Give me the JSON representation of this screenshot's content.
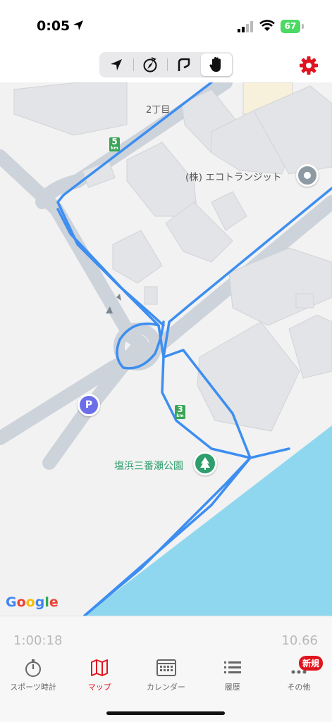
{
  "status_bar": {
    "time": "0:05",
    "battery": "67"
  },
  "toolbar": {
    "modes": [
      "location-arrow-icon",
      "compass-icon",
      "route-icon",
      "hand-icon"
    ],
    "active_mode": "hand-icon",
    "settings_icon": "gear-icon",
    "accent_color": "#e0141e"
  },
  "map": {
    "labels": {
      "block": "2丁目",
      "company": "(株) エコトランジット",
      "park": "塩浜三番瀬公園"
    },
    "km_markers": [
      {
        "value": "5",
        "unit": "km"
      },
      {
        "value": "3",
        "unit": "km"
      }
    ],
    "parking": "P",
    "attribution": "Google",
    "route_color": "#3d8ef0",
    "water_color": "#8fd7ee"
  },
  "stats": {
    "elapsed": "1:00:18",
    "distance": "10.66"
  },
  "tabs": [
    {
      "label": "スポーツ時計",
      "icon": "stopwatch-icon"
    },
    {
      "label": "マップ",
      "icon": "map-icon"
    },
    {
      "label": "カレンダー",
      "icon": "calendar-icon"
    },
    {
      "label": "履歴",
      "icon": "list-icon"
    },
    {
      "label": "その他",
      "icon": "more-icon",
      "badge": "新規"
    }
  ],
  "active_tab": "マップ"
}
